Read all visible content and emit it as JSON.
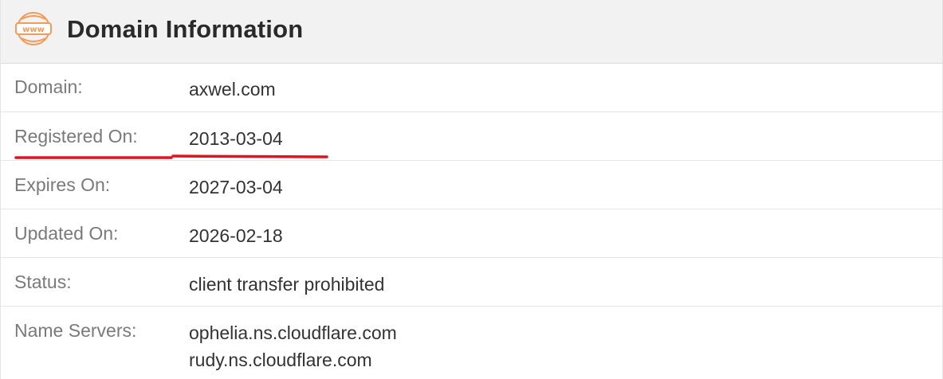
{
  "header": {
    "icon": "www-icon",
    "icon_text": "www",
    "title": "Domain Information",
    "accent_color": "#f39b58"
  },
  "rows": [
    {
      "label": "Domain:",
      "value": "axwel.com"
    },
    {
      "label": "Registered On:",
      "value": "2013-03-04"
    },
    {
      "label": "Expires On:",
      "value": "2027-03-04"
    },
    {
      "label": "Updated On:",
      "value": "2026-02-18"
    },
    {
      "label": "Status:",
      "value": "client transfer prohibited"
    },
    {
      "label": "Name Servers:",
      "values": [
        "ophelia.ns.cloudflare.com",
        "rudy.ns.cloudflare.com"
      ]
    }
  ],
  "annotation": {
    "type": "red-underline",
    "target": "Registered On: 2013-03-04",
    "color": "#e0141e"
  }
}
